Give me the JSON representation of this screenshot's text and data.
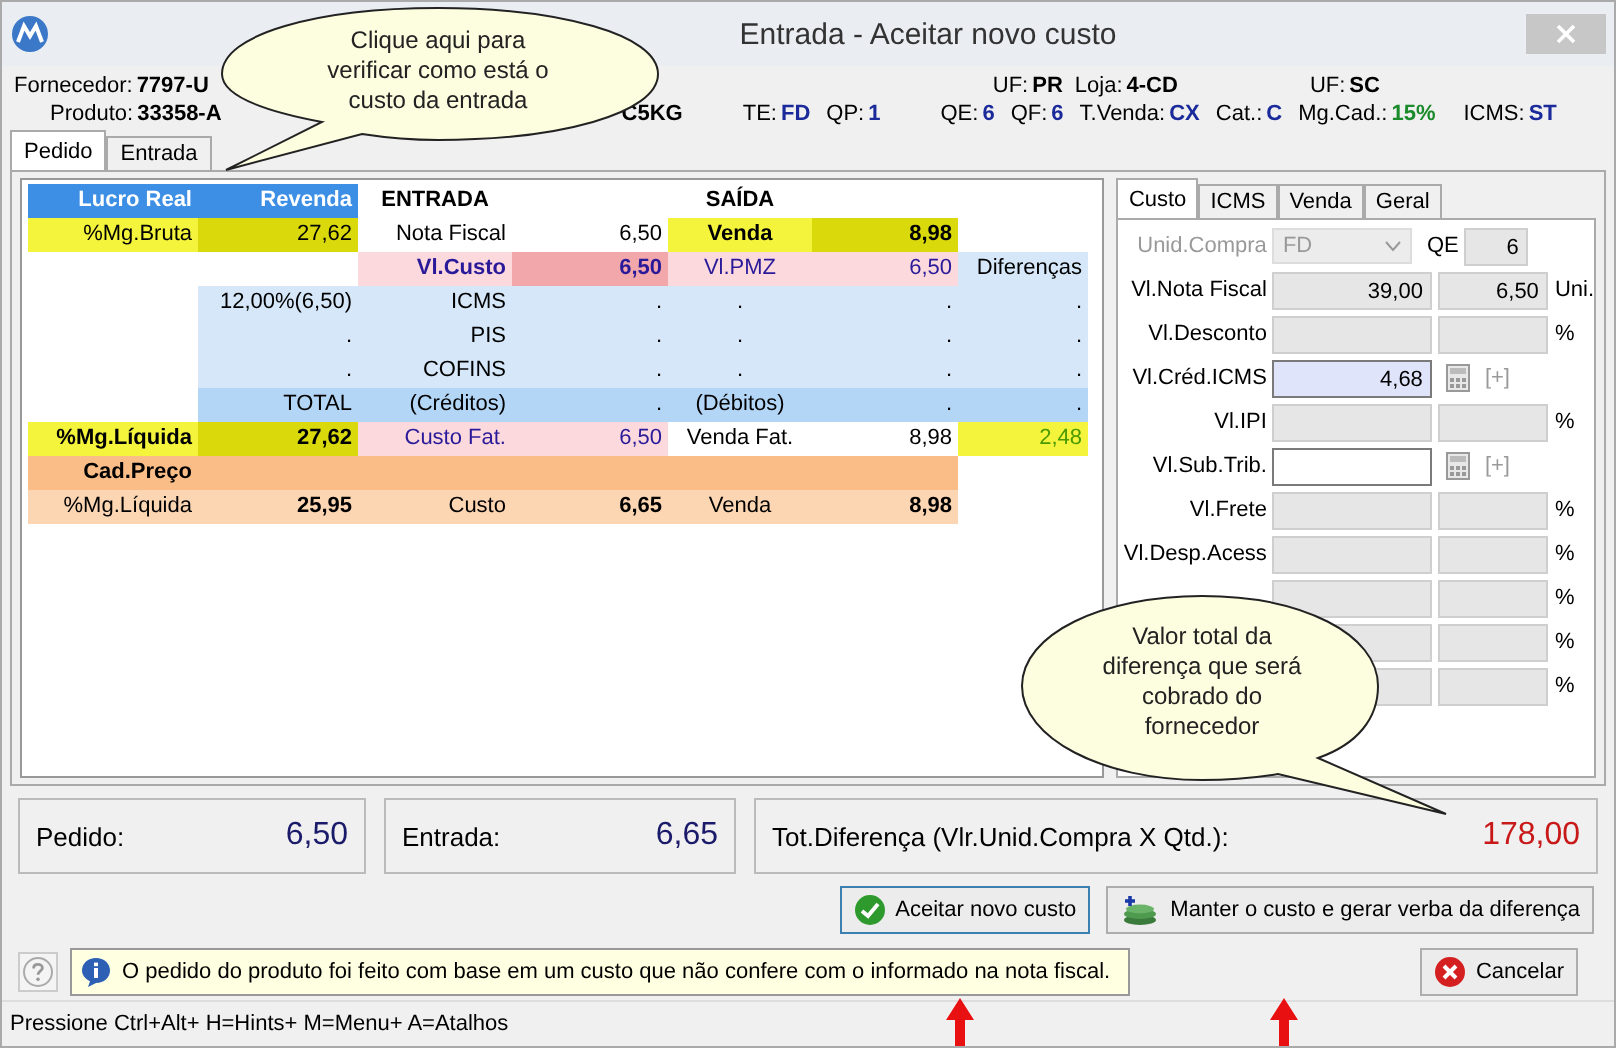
{
  "window": {
    "title": "Entrada - Aceitar novo custo"
  },
  "header": {
    "line1": [
      {
        "label": "Fornecedor:",
        "value": "7797-U",
        "color": "#000000"
      },
      {
        "label": "UF:",
        "value": "PR",
        "color": "#000000"
      },
      {
        "label": "Loja:",
        "value": "4-CD",
        "color": "#000000"
      },
      {
        "label": "UF:",
        "value": "SC",
        "color": "#000000"
      }
    ],
    "line2": [
      {
        "label": "Produto:",
        "value": "33358-A",
        "color": "#000000"
      },
      {
        "value": "C5KG",
        "color": "#000000"
      },
      {
        "label": "TE:",
        "value": "FD",
        "color": "#1a2a9a"
      },
      {
        "label": "QP:",
        "value": "1",
        "color": "#1a2a9a"
      },
      {
        "label": "QE:",
        "value": "6",
        "color": "#1a2a9a"
      },
      {
        "label": "QF:",
        "value": "6",
        "color": "#1a2a9a"
      },
      {
        "label": "T.Venda:",
        "value": "CX",
        "color": "#1a2a9a"
      },
      {
        "label": "Cat.:",
        "value": "C",
        "color": "#1a2a9a"
      },
      {
        "label": "Mg.Cad.:",
        "value": "15%",
        "color": "#1a8a2a"
      },
      {
        "label": "ICMS:",
        "value": "ST",
        "color": "#1a2a9a"
      }
    ]
  },
  "tabs": [
    {
      "label": "Pedido",
      "selected": true
    },
    {
      "label": "Entrada",
      "selected": false
    }
  ],
  "grid": [
    [
      {
        "text": "Lucro Real",
        "kind": "head",
        "bold": true
      },
      {
        "text": "Revenda",
        "kind": "head",
        "bold": true
      },
      {
        "text": "ENTRADA",
        "kind": "title",
        "bold": true
      },
      {
        "kind": "white"
      },
      {
        "text": "SAÍDA",
        "kind": "title",
        "bold": true
      },
      {
        "kind": "white"
      },
      {
        "kind": "white"
      }
    ],
    [
      {
        "text": "%Mg.Bruta",
        "kind": "yellow",
        "bold": false
      },
      {
        "text": "27,62",
        "kind": "olive",
        "bold": false
      },
      {
        "text": "Nota Fiscal",
        "kind": "white",
        "bold": false
      },
      {
        "text": "6,50",
        "kind": "white",
        "bold": false
      },
      {
        "text": "Venda",
        "kind": "yellow",
        "bold": true
      },
      {
        "text": "8,98",
        "kind": "olive",
        "bold": true
      },
      {
        "kind": "white"
      }
    ],
    [
      {
        "kind": "white"
      },
      {
        "kind": "white"
      },
      {
        "text": "Vl.Custo",
        "kind": "pink",
        "bold": true
      },
      {
        "text": "6,50",
        "kind": "rose",
        "bold": true
      },
      {
        "text": "Vl.PMZ",
        "kind": "pink",
        "bold": false
      },
      {
        "text": "6,50",
        "kind": "pink",
        "bold": false
      },
      {
        "text": "Diferenças",
        "kind": "light",
        "bold": false
      }
    ],
    [
      {
        "kind": "white"
      },
      {
        "text": "12,00%(6,50)",
        "kind": "light",
        "bold": false
      },
      {
        "text": "ICMS",
        "kind": "light",
        "bold": false
      },
      {
        "text": ".",
        "kind": "light",
        "bold": false
      },
      {
        "text": ".",
        "kind": "light",
        "bold": false
      },
      {
        "text": ".",
        "kind": "light",
        "bold": false
      },
      {
        "text": ".",
        "kind": "light",
        "bold": false
      }
    ],
    [
      {
        "kind": "white"
      },
      {
        "text": ".",
        "kind": "light",
        "bold": false
      },
      {
        "text": "PIS",
        "kind": "light",
        "bold": false
      },
      {
        "text": ".",
        "kind": "light",
        "bold": false
      },
      {
        "text": ".",
        "kind": "light",
        "bold": false
      },
      {
        "text": ".",
        "kind": "light",
        "bold": false
      },
      {
        "text": ".",
        "kind": "light",
        "bold": false
      }
    ],
    [
      {
        "kind": "white"
      },
      {
        "text": ".",
        "kind": "light",
        "bold": false
      },
      {
        "text": "COFINS",
        "kind": "light",
        "bold": false
      },
      {
        "text": ".",
        "kind": "light",
        "bold": false
      },
      {
        "text": ".",
        "kind": "light",
        "bold": false
      },
      {
        "text": ".",
        "kind": "light",
        "bold": false
      },
      {
        "text": ".",
        "kind": "light",
        "bold": false
      }
    ],
    [
      {
        "kind": "white"
      },
      {
        "text": "TOTAL",
        "kind": "mid",
        "bold": false
      },
      {
        "text": "(Créditos)",
        "kind": "mid",
        "bold": false
      },
      {
        "text": ".",
        "kind": "mid",
        "bold": false
      },
      {
        "text": "(Débitos)",
        "kind": "mid",
        "bold": false
      },
      {
        "text": ".",
        "kind": "mid",
        "bold": false
      },
      {
        "text": ".",
        "kind": "mid",
        "bold": false
      }
    ],
    [
      {
        "text": "%Mg.Líquida",
        "kind": "yellow",
        "bold": true
      },
      {
        "text": "27,62",
        "kind": "olive",
        "bold": true
      },
      {
        "text": "Custo Fat.",
        "kind": "pink",
        "bold": false
      },
      {
        "text": "6,50",
        "kind": "pink",
        "bold": false
      },
      {
        "text": "Venda Fat.",
        "kind": "white",
        "bold": false
      },
      {
        "text": "8,98",
        "kind": "white",
        "bold": false
      },
      {
        "text": "2,48",
        "kind": "lime",
        "bold": false
      }
    ],
    [
      {
        "text": "Cad.Preço",
        "kind": "orange",
        "bold": true
      },
      {
        "kind": "orange"
      },
      {
        "kind": "orange"
      },
      {
        "kind": "orange"
      },
      {
        "kind": "orange"
      },
      {
        "kind": "orange"
      },
      {
        "kind": "white"
      }
    ],
    [
      {
        "text": "%Mg.Líquida",
        "kind": "peach",
        "bold": false
      },
      {
        "text": "25,95",
        "kind": "peach",
        "bold": true
      },
      {
        "text": "Custo",
        "kind": "peach",
        "bold": false
      },
      {
        "text": "6,65",
        "kind": "peach",
        "bold": true
      },
      {
        "text": "Venda",
        "kind": "peach",
        "bold": false
      },
      {
        "text": "8,98",
        "kind": "peach",
        "bold": true
      },
      {
        "kind": "white"
      }
    ]
  ],
  "side_tabs": [
    {
      "label": "Custo",
      "selected": true
    },
    {
      "label": "ICMS",
      "selected": false
    },
    {
      "label": "Venda",
      "selected": false
    },
    {
      "label": "Geral",
      "selected": false
    }
  ],
  "side_rows": [
    {
      "kind": "select",
      "label": "Unid.Compra",
      "disabled": true,
      "value": "FD",
      "qe_label": "QE",
      "qe_value": "6"
    },
    {
      "kind": "pair",
      "label": "Vl.Nota Fiscal",
      "field": {
        "value": "39,00",
        "disabled": true,
        "focused": false
      },
      "field2": {
        "value": "6,50",
        "disabled": true
      },
      "suffix": "Uni."
    },
    {
      "kind": "pair",
      "label": "Vl.Desconto",
      "field": {
        "disabled": true,
        "focused": false
      },
      "field2": {
        "disabled": true
      },
      "suffix": "%"
    },
    {
      "kind": "calc",
      "label": "Vl.Créd.ICMS",
      "field": {
        "value": "4,68",
        "disabled": false,
        "focused": true
      },
      "extra": "[+]"
    },
    {
      "kind": "pair",
      "label": "Vl.IPI",
      "field": {
        "disabled": true,
        "focused": false
      },
      "field2": {
        "disabled": true
      },
      "suffix": "%"
    },
    {
      "kind": "calc",
      "label": "Vl.Sub.Trib.",
      "field": {
        "disabled": false,
        "focused": false
      },
      "extra": "[+]"
    },
    {
      "kind": "pair",
      "label": "Vl.Frete",
      "field": {
        "disabled": true,
        "focused": false
      },
      "field2": {
        "disabled": true
      },
      "suffix": "%"
    },
    {
      "kind": "pair",
      "label": "Vl.Desp.Acess",
      "field": {
        "disabled": true,
        "focused": false
      },
      "field2": {
        "disabled": true
      },
      "suffix": "%"
    },
    {
      "kind": "pair",
      "field": {
        "disabled": true,
        "focused": false
      },
      "field2": {
        "disabled": true
      },
      "suffix": "%"
    },
    {
      "kind": "pair",
      "field": {
        "disabled": true,
        "focused": false
      },
      "field2": {
        "disabled": true
      },
      "suffix": "%"
    },
    {
      "kind": "pair",
      "field": {
        "disabled": true,
        "focused": false
      },
      "field2": {
        "disabled": true
      },
      "suffix": "%"
    }
  ],
  "callouts": [
    {
      "text": "Clique aqui para verificar como está o custo da entrada"
    },
    {
      "text": "Valor total da diferença que será cobrado do fornecedor"
    }
  ],
  "totals": [
    {
      "label": "Pedido:",
      "value": "6,50",
      "color": "#1a1a6a"
    },
    {
      "label": "Entrada:",
      "value": "6,65",
      "color": "#1a1a6a"
    },
    {
      "label": "Tot.Diferença (Vlr.Unid.Compra X Qtd.):",
      "value": "178,00",
      "color": "#c81818"
    }
  ],
  "buttons": [
    {
      "label": "Aceitar novo custo",
      "kind": "accept",
      "focused": true
    },
    {
      "label": "Manter o custo e gerar verba da diferença",
      "kind": "keep",
      "focused": false
    }
  ],
  "message": "O pedido do produto foi feito com base em um custo que não confere com o informado na nota fiscal.",
  "cancel": {
    "label": "Cancelar"
  },
  "status_bar": "Pressione Ctrl+Alt+ H=Hints+ M=Menu+ A=Atalhos"
}
